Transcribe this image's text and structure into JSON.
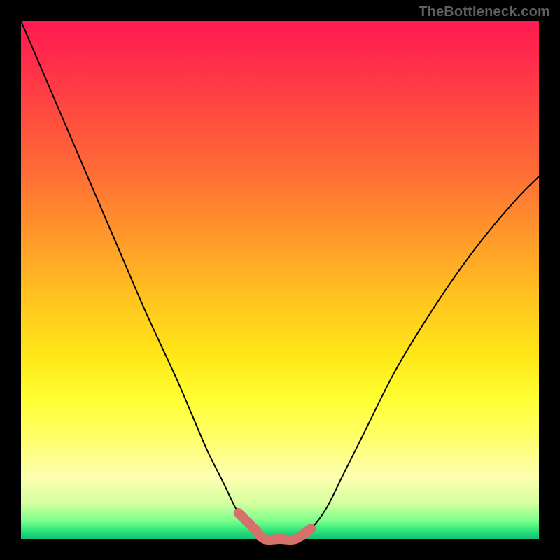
{
  "watermark": "TheBottleneck.com",
  "colors": {
    "curve_stroke": "#000000",
    "bottom_highlight": "#d6706a",
    "gradient_top": "#ff1a52",
    "gradient_bottom": "#15c27a"
  },
  "chart_data": {
    "type": "line",
    "title": "",
    "xlabel": "",
    "ylabel": "",
    "xlim": [
      0,
      100
    ],
    "ylim": [
      0,
      100
    ],
    "grid": false,
    "legend": false,
    "series": [
      {
        "name": "bottleneck-curve",
        "x": [
          0,
          6,
          12,
          18,
          24,
          30,
          33,
          36,
          39,
          42,
          45,
          47,
          50,
          53,
          56,
          59,
          62,
          66,
          72,
          78,
          84,
          90,
          96,
          100
        ],
        "y": [
          100,
          86,
          72,
          58,
          44,
          31,
          24,
          17,
          11,
          5,
          2,
          0,
          0,
          0,
          2,
          6,
          12,
          20,
          32,
          42,
          51,
          59,
          66,
          70
        ]
      }
    ],
    "highlight": {
      "name": "bottom-plateau",
      "x": [
        42,
        45,
        47,
        50,
        53,
        56
      ],
      "y": [
        5,
        2,
        0,
        0,
        0,
        2
      ]
    }
  }
}
